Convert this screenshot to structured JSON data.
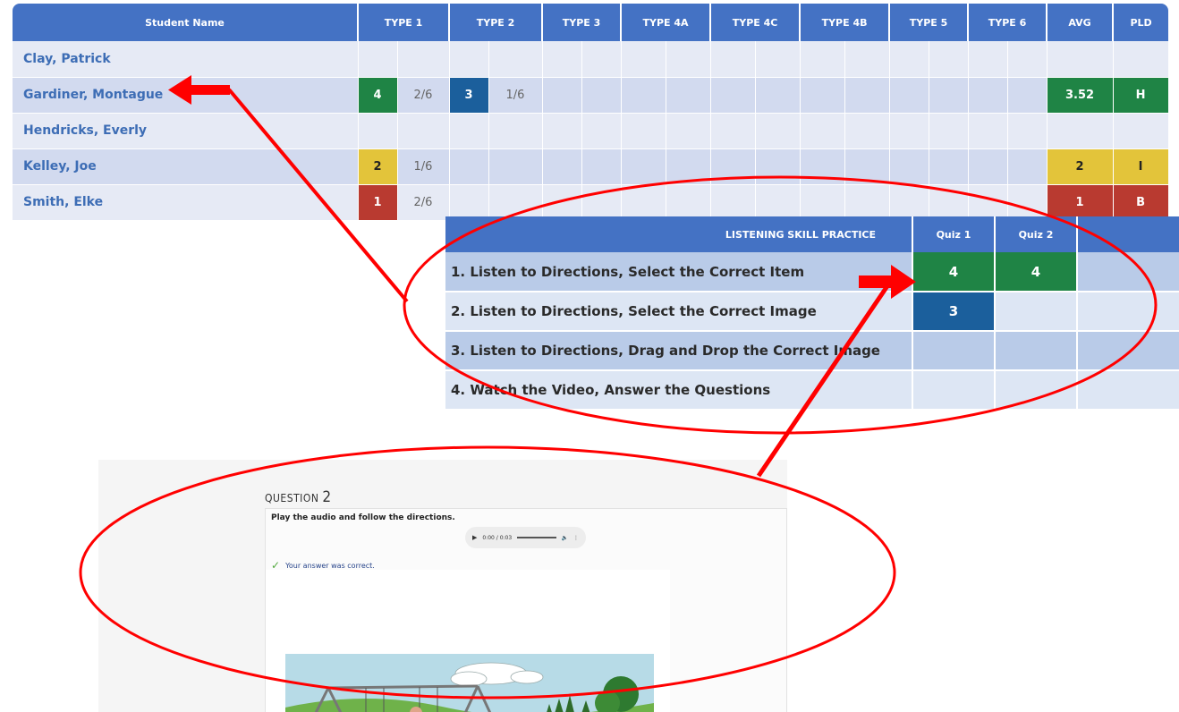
{
  "gradebook": {
    "headers": [
      "Student Name",
      "TYPE 1",
      "TYPE 2",
      "TYPE 3",
      "TYPE 4A",
      "TYPE 4C",
      "TYPE 4B",
      "TYPE 5",
      "TYPE 6",
      "AVG",
      "PLD"
    ],
    "students": [
      {
        "name": "Clay, Patrick",
        "t1_score": "",
        "t1_frac": "",
        "t2_score": "",
        "t2_frac": "",
        "avg": "",
        "pld": ""
      },
      {
        "name": "Gardiner, Montague",
        "t1_score": "4",
        "t1_frac": "2/6",
        "t2_score": "3",
        "t2_frac": "1/6",
        "avg": "3.52",
        "pld": "H"
      },
      {
        "name": "Hendricks, Everly",
        "t1_score": "",
        "t1_frac": "",
        "t2_score": "",
        "t2_frac": "",
        "avg": "",
        "pld": ""
      },
      {
        "name": "Kelley, Joe",
        "t1_score": "2",
        "t1_frac": "1/6",
        "t2_score": "",
        "t2_frac": "",
        "avg": "2",
        "pld": "I"
      },
      {
        "name": "Smith, Elke",
        "t1_score": "1",
        "t1_frac": "2/6",
        "t2_score": "",
        "t2_frac": "",
        "avg": "1",
        "pld": "B"
      }
    ]
  },
  "skills": {
    "header": "LISTENING SKILL PRACTICE",
    "quiz_headers": [
      "Quiz 1",
      "Quiz 2"
    ],
    "rows": [
      {
        "label": "1. Listen to Directions, Select the Correct Item",
        "q1": "4",
        "q2": "4"
      },
      {
        "label": "2. Listen to Directions, Select the Correct Image",
        "q1": "3",
        "q2": ""
      },
      {
        "label": "3. Listen to Directions, Drag and Drop the Correct Image",
        "q1": "",
        "q2": ""
      },
      {
        "label": "4. Watch the Video, Answer the Questions",
        "q1": "",
        "q2": ""
      }
    ]
  },
  "question": {
    "title_word": "QUESTION",
    "number": "2",
    "instructions": "Play the audio and follow the directions.",
    "audio_time": "0:00 / 0:03",
    "feedback": "Your answer was correct."
  },
  "colors": {
    "header_blue": "#4472c4",
    "score_4": "#1f8445",
    "score_3": "#1b5f9c",
    "score_2": "#e3c43a",
    "score_1": "#b93a30",
    "annotation_red": "#ff0000"
  },
  "icons": {
    "play": "play-icon",
    "volume": "volume-icon",
    "more": "more-vert-icon",
    "check": "check-icon"
  }
}
